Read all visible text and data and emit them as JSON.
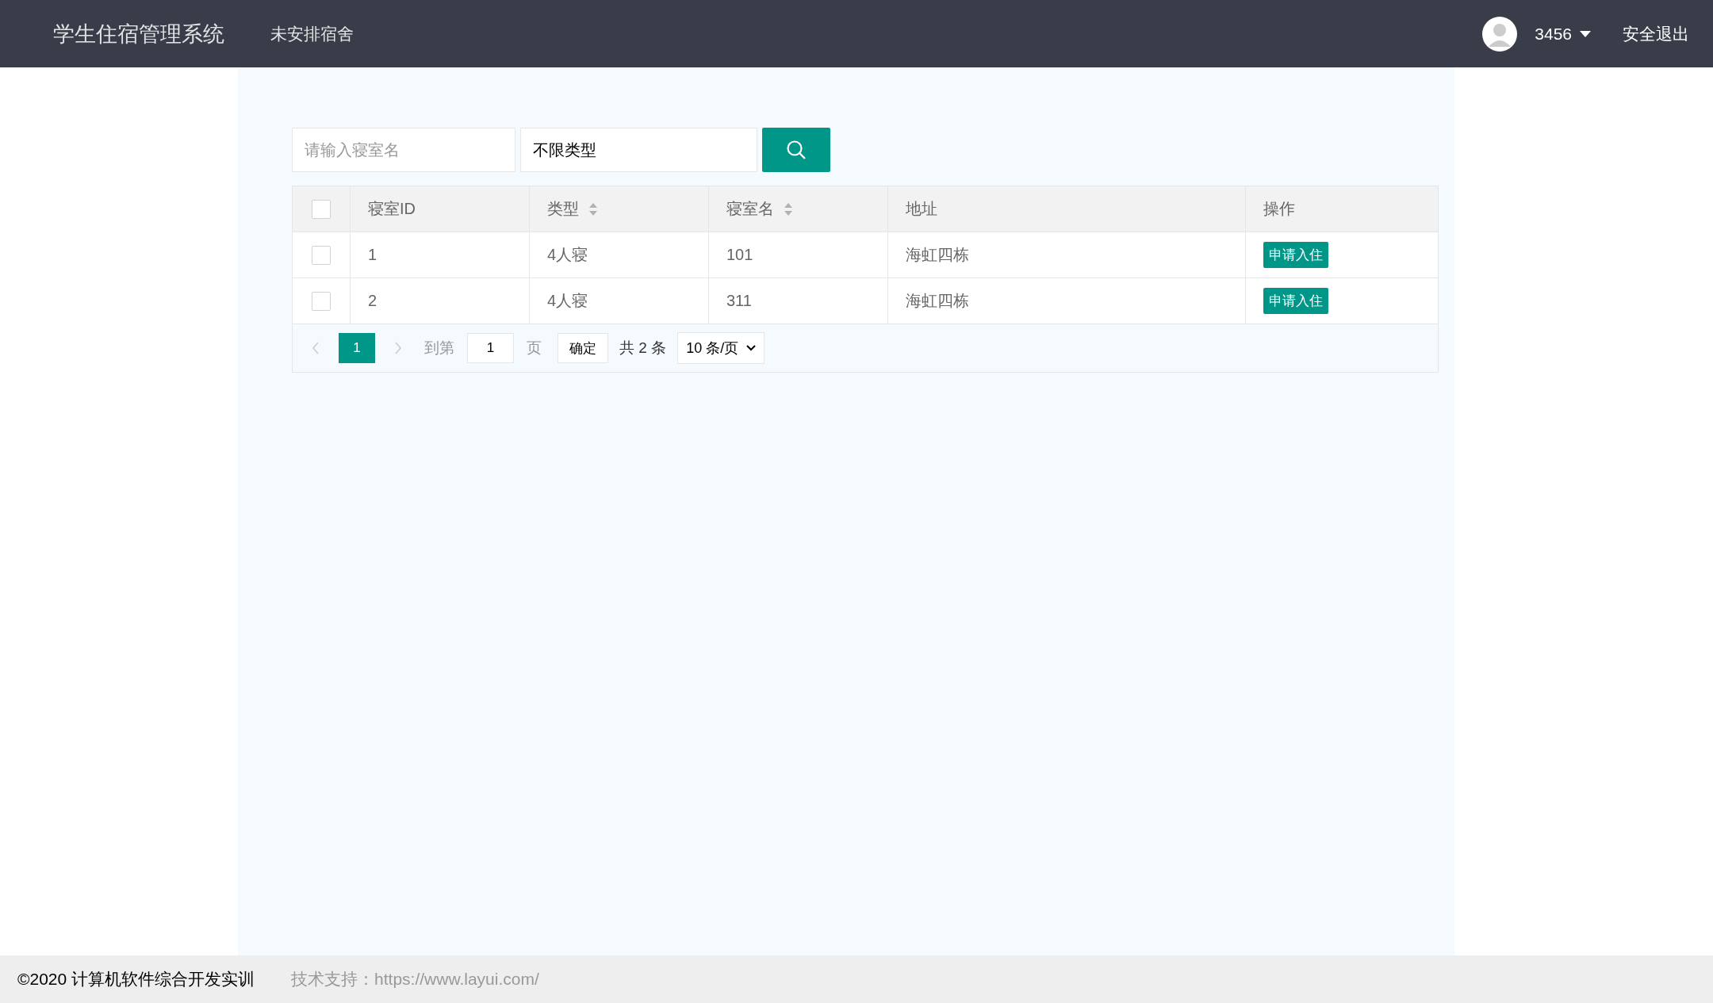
{
  "header": {
    "title": "学生住宿管理系统",
    "nav": [
      "未安排宿舍"
    ],
    "user": {
      "name": "3456"
    },
    "logout": "安全退出"
  },
  "search": {
    "placeholder": "请输入寝室名",
    "type_value": "不限类型"
  },
  "table": {
    "select_all_checked": false,
    "columns": [
      {
        "label": "寝室ID",
        "sortable": false
      },
      {
        "label": "类型",
        "sortable": true
      },
      {
        "label": "寝室名",
        "sortable": true
      },
      {
        "label": "地址",
        "sortable": false
      },
      {
        "label": "操作",
        "sortable": false
      }
    ],
    "rows": [
      {
        "checked": false,
        "cells": [
          "1",
          "4人寝",
          "101",
          "海虹四栋"
        ],
        "action": "申请入住"
      },
      {
        "checked": false,
        "cells": [
          "2",
          "4人寝",
          "311",
          "海虹四栋"
        ],
        "action": "申请入住"
      }
    ]
  },
  "pager": {
    "pages": [
      {
        "label": "1",
        "selected": true
      }
    ],
    "goto_label": "到第",
    "goto_value": "1",
    "page_suffix": "页",
    "confirm": "确定",
    "total": "共 2 条",
    "page_size": "10 条/页"
  },
  "footer": {
    "copyright": "©2020 计算机软件综合开发实训",
    "support": "技术支持：https://www.layui.com/"
  }
}
